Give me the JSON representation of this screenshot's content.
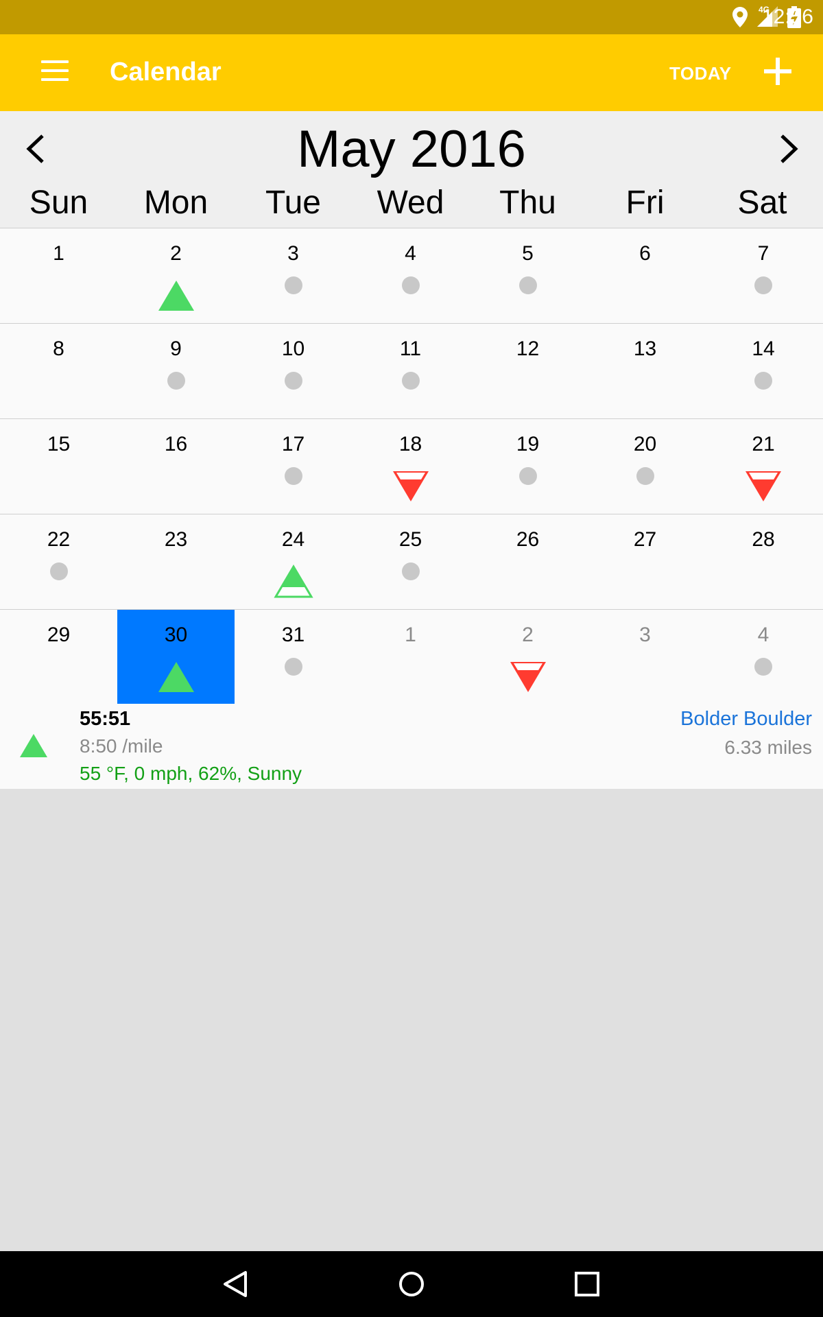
{
  "status_bar": {
    "time": "12:56",
    "network": "4G",
    "icons": [
      "location-icon",
      "signal-icon",
      "battery-charging-icon"
    ]
  },
  "app_bar": {
    "title": "Calendar",
    "today_label": "TODAY",
    "background_color": "#ffcc00",
    "icons": [
      "menu-icon",
      "add-icon"
    ]
  },
  "calendar": {
    "month_title": "May 2016",
    "weekdays": [
      "Sun",
      "Mon",
      "Tue",
      "Wed",
      "Thu",
      "Fri",
      "Sat"
    ],
    "selected_color": "#0079ff",
    "weeks": [
      [
        {
          "day": "1",
          "marker": "none"
        },
        {
          "day": "2",
          "marker": "green-up"
        },
        {
          "day": "3",
          "marker": "dot"
        },
        {
          "day": "4",
          "marker": "dot"
        },
        {
          "day": "5",
          "marker": "dot"
        },
        {
          "day": "6",
          "marker": "none"
        },
        {
          "day": "7",
          "marker": "dot"
        }
      ],
      [
        {
          "day": "8",
          "marker": "none"
        },
        {
          "day": "9",
          "marker": "dot"
        },
        {
          "day": "10",
          "marker": "dot"
        },
        {
          "day": "11",
          "marker": "dot"
        },
        {
          "day": "12",
          "marker": "none"
        },
        {
          "day": "13",
          "marker": "none"
        },
        {
          "day": "14",
          "marker": "dot"
        }
      ],
      [
        {
          "day": "15",
          "marker": "none"
        },
        {
          "day": "16",
          "marker": "none"
        },
        {
          "day": "17",
          "marker": "dot"
        },
        {
          "day": "18",
          "marker": "red-down"
        },
        {
          "day": "19",
          "marker": "dot"
        },
        {
          "day": "20",
          "marker": "dot"
        },
        {
          "day": "21",
          "marker": "red-down"
        }
      ],
      [
        {
          "day": "22",
          "marker": "dot"
        },
        {
          "day": "23",
          "marker": "none"
        },
        {
          "day": "24",
          "marker": "green-up-outline"
        },
        {
          "day": "25",
          "marker": "dot"
        },
        {
          "day": "26",
          "marker": "none"
        },
        {
          "day": "27",
          "marker": "none"
        },
        {
          "day": "28",
          "marker": "none"
        }
      ],
      [
        {
          "day": "29",
          "marker": "none"
        },
        {
          "day": "30",
          "marker": "green-up",
          "selected": true
        },
        {
          "day": "31",
          "marker": "dot"
        },
        {
          "day": "1",
          "marker": "none",
          "other_month": true
        },
        {
          "day": "2",
          "marker": "red-down",
          "other_month": true
        },
        {
          "day": "3",
          "marker": "none",
          "other_month": true
        },
        {
          "day": "4",
          "marker": "dot",
          "other_month": true
        }
      ]
    ]
  },
  "run": {
    "duration": "55:51",
    "pace": "8:50 /mile",
    "weather": "55 °F, 0 mph, 62%, Sunny",
    "name": "Bolder Boulder",
    "distance": "6.33 miles",
    "icon": "green-up-triangle-icon"
  },
  "nav_bar": {
    "icons": [
      "back-icon",
      "home-icon",
      "recents-icon"
    ]
  }
}
